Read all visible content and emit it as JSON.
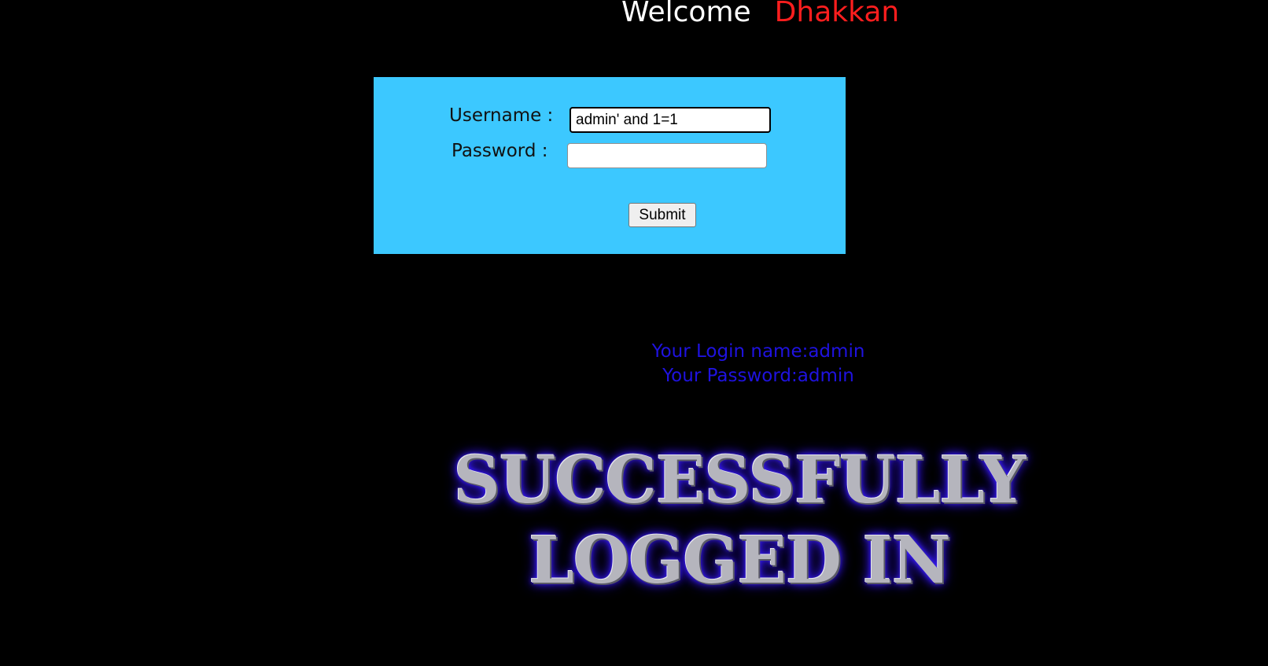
{
  "header": {
    "welcome_text": "Welcome",
    "name_text": "Dhakkan"
  },
  "login_form": {
    "username_label": "Username :",
    "password_label": "Password :",
    "username_value": "admin' and 1=1",
    "password_value": "",
    "submit_label": "Submit"
  },
  "result": {
    "login_name_line": "Your Login name:admin",
    "password_line": "Your Password:admin"
  },
  "banner": {
    "line1": "SUCCESSFULLY",
    "line2": "LOGGED IN"
  },
  "colors": {
    "background": "#000000",
    "form_bg": "#3cc8ff",
    "name_accent": "#ff1e1e",
    "result_text": "#1f12e0",
    "banner_glow": "#3b1dff"
  }
}
